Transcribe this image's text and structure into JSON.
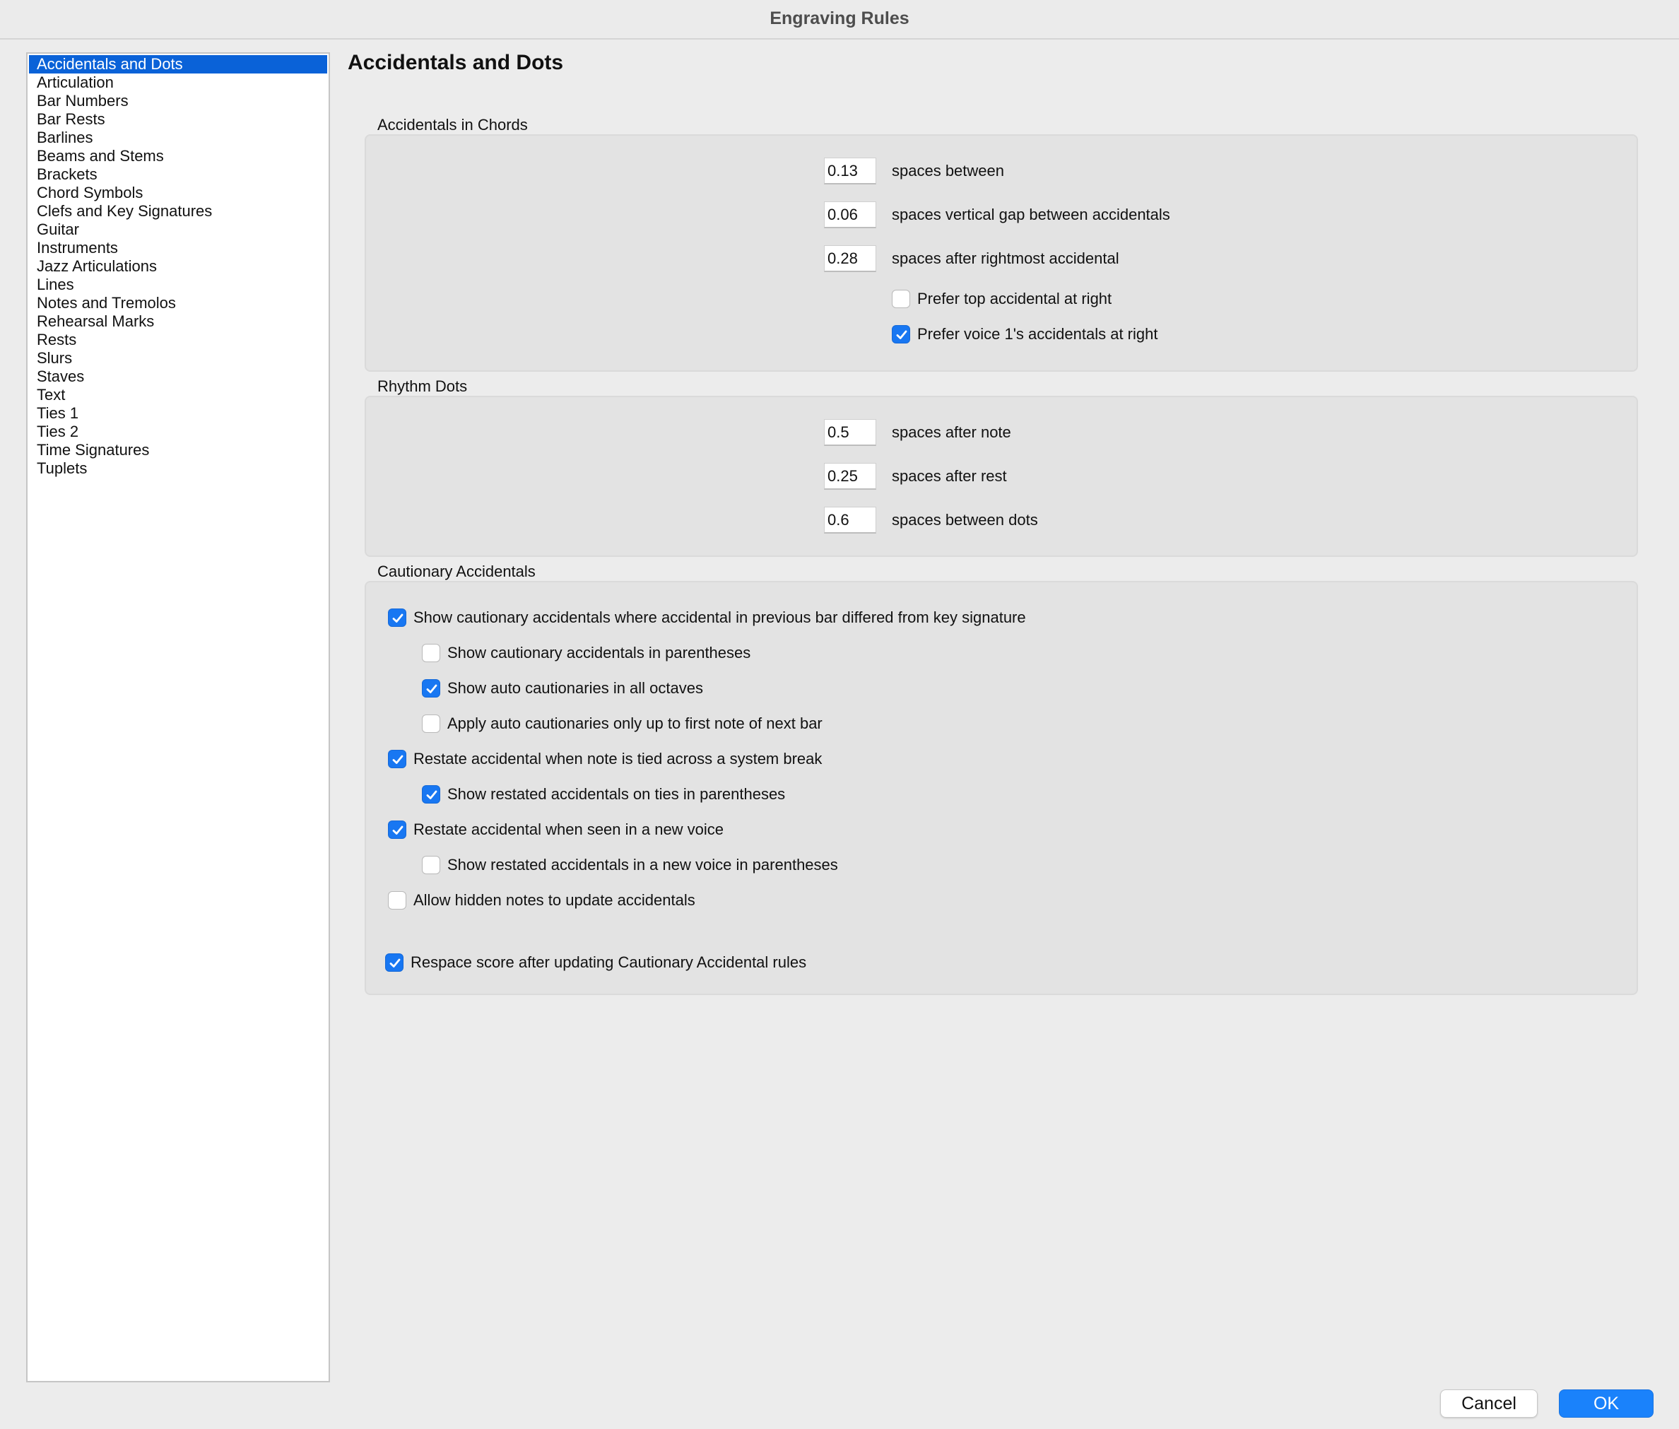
{
  "window": {
    "title": "Engraving Rules"
  },
  "sidebar": {
    "items": [
      {
        "label": "Accidentals and Dots",
        "selected": true
      },
      {
        "label": "Articulation"
      },
      {
        "label": "Bar Numbers"
      },
      {
        "label": "Bar Rests"
      },
      {
        "label": "Barlines"
      },
      {
        "label": "Beams and Stems"
      },
      {
        "label": "Brackets"
      },
      {
        "label": "Chord Symbols"
      },
      {
        "label": "Clefs and Key Signatures"
      },
      {
        "label": "Guitar"
      },
      {
        "label": "Instruments"
      },
      {
        "label": "Jazz Articulations"
      },
      {
        "label": "Lines"
      },
      {
        "label": "Notes and Tremolos"
      },
      {
        "label": "Rehearsal Marks"
      },
      {
        "label": "Rests"
      },
      {
        "label": "Slurs"
      },
      {
        "label": "Staves"
      },
      {
        "label": "Text"
      },
      {
        "label": "Ties 1"
      },
      {
        "label": "Ties 2"
      },
      {
        "label": "Time Signatures"
      },
      {
        "label": "Tuplets"
      }
    ]
  },
  "main": {
    "title": "Accidentals and Dots",
    "chords": {
      "heading": "Accidentals in Chords",
      "fields": [
        {
          "value": "0.13",
          "label": "spaces between"
        },
        {
          "value": "0.06",
          "label": "spaces vertical gap between accidentals"
        },
        {
          "value": "0.28",
          "label": "spaces after rightmost accidental"
        }
      ],
      "checks": [
        {
          "label": "Prefer top accidental at right",
          "checked": false
        },
        {
          "label": "Prefer voice 1's accidentals at right",
          "checked": true
        }
      ]
    },
    "dots": {
      "heading": "Rhythm Dots",
      "fields": [
        {
          "value": "0.5",
          "label": "spaces after note"
        },
        {
          "value": "0.25",
          "label": "spaces after rest"
        },
        {
          "value": "0.6",
          "label": "spaces between dots"
        }
      ]
    },
    "cautionary": {
      "heading": "Cautionary Accidentals",
      "checks": [
        {
          "label": "Show cautionary accidentals where accidental in previous bar differed from key signature",
          "checked": true
        },
        {
          "label": "Show cautionary accidentals in parentheses",
          "checked": false
        },
        {
          "label": "Show auto cautionaries in all octaves",
          "checked": true
        },
        {
          "label": "Apply auto cautionaries only up to first note of next bar",
          "checked": false
        },
        {
          "label": "Restate accidental when note is tied across a system break",
          "checked": true
        },
        {
          "label": "Show restated accidentals on ties in parentheses",
          "checked": true
        },
        {
          "label": "Restate accidental when seen in a new voice",
          "checked": true
        },
        {
          "label": "Show restated accidentals in a new voice in parentheses",
          "checked": false
        },
        {
          "label": "Allow hidden notes to update accidentals",
          "checked": false
        },
        {
          "label": "Respace score after updating Cautionary Accidental rules",
          "checked": true
        }
      ]
    }
  },
  "buttons": {
    "cancel": "Cancel",
    "ok": "OK"
  },
  "colors": {
    "accent": "#1a82fb",
    "selection": "#0a62d8"
  }
}
